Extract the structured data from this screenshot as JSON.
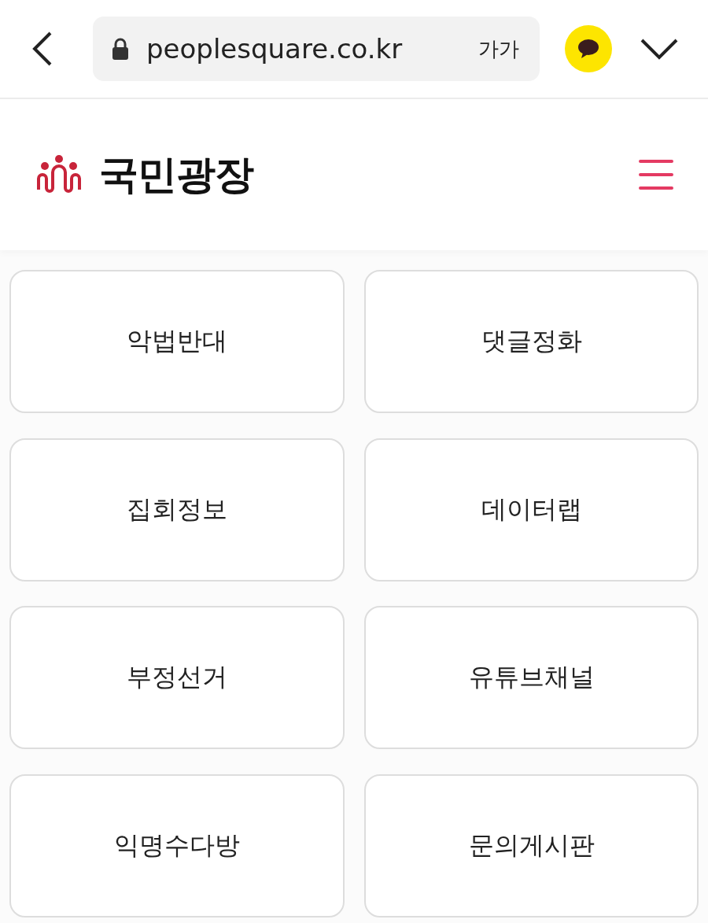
{
  "browser_bar": {
    "url": "peoplesquare.co.kr",
    "text_size_button": "가가"
  },
  "header": {
    "site_title": "국민광장"
  },
  "menu_tiles": [
    {
      "label": "악법반대"
    },
    {
      "label": "댓글정화"
    },
    {
      "label": "집회정보"
    },
    {
      "label": "데이터랩"
    },
    {
      "label": "부정선거"
    },
    {
      "label": "유튜브채널"
    },
    {
      "label": "익명수다방"
    },
    {
      "label": "문의게시판"
    }
  ]
}
